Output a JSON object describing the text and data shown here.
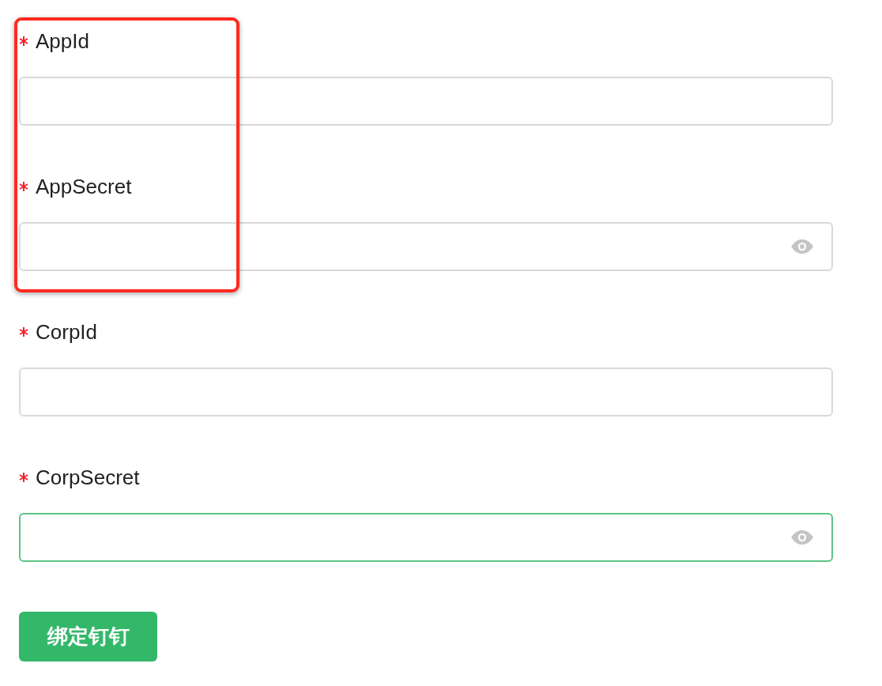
{
  "fields": [
    {
      "label": "AppId",
      "required": true,
      "kind": "text",
      "focused": false,
      "highlighted": true
    },
    {
      "label": "AppSecret",
      "required": true,
      "kind": "password",
      "focused": false,
      "highlighted": true
    },
    {
      "label": "CorpId",
      "required": true,
      "kind": "text",
      "focused": false,
      "highlighted": false
    },
    {
      "label": "CorpSecret",
      "required": true,
      "kind": "password",
      "focused": true,
      "highlighted": false
    }
  ],
  "submit_button": {
    "label": "绑定钉钉"
  }
}
